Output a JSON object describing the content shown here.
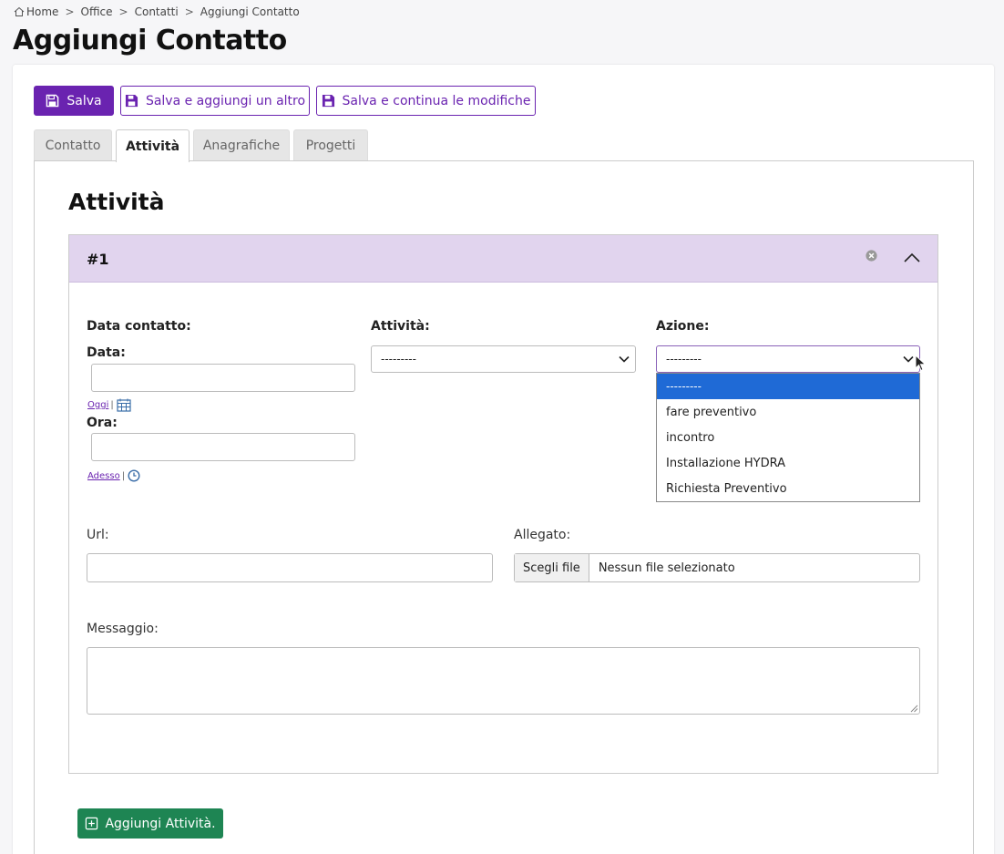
{
  "breadcrumb": {
    "home": "Home",
    "office": "Office",
    "contatti": "Contatti",
    "current": "Aggiungi Contatto",
    "separator": ">"
  },
  "page": {
    "title": "Aggiungi Contatto"
  },
  "toolbar": {
    "save": "Salva",
    "save_add": "Salva e aggiungi un altro",
    "save_continue": "Salva e continua le modifiche"
  },
  "tabs": [
    {
      "label": "Contatto"
    },
    {
      "label": "Attività"
    },
    {
      "label": "Anagrafiche"
    },
    {
      "label": "Progetti"
    }
  ],
  "active_tab": "Attività",
  "section": {
    "title": "Attività"
  },
  "inline": {
    "number": "#1",
    "data_contatto_label": "Data contatto:",
    "data_label": "Data:",
    "today_link": "Oggi",
    "ora_label": "Ora:",
    "now_link": "Adesso",
    "separator": "|",
    "attivita_label": "Attività:",
    "attivita_value": "---------",
    "azione_label": "Azione:",
    "azione_value": "---------",
    "azione_options": [
      "---------",
      "fare preventivo",
      "incontro",
      "Installazione HYDRA",
      "Richiesta Preventivo"
    ],
    "url_label": "Url:",
    "allegato_label": "Allegato:",
    "file_button": "Scegli file",
    "file_status": "Nessun file selezionato",
    "messaggio_label": "Messaggio:"
  },
  "add_activity": "Aggiungi Attività.",
  "colors": {
    "primary": "#6a23b0",
    "header": "#e1d4ee",
    "success": "#1e8553",
    "option_selected": "#1f6ad6"
  }
}
